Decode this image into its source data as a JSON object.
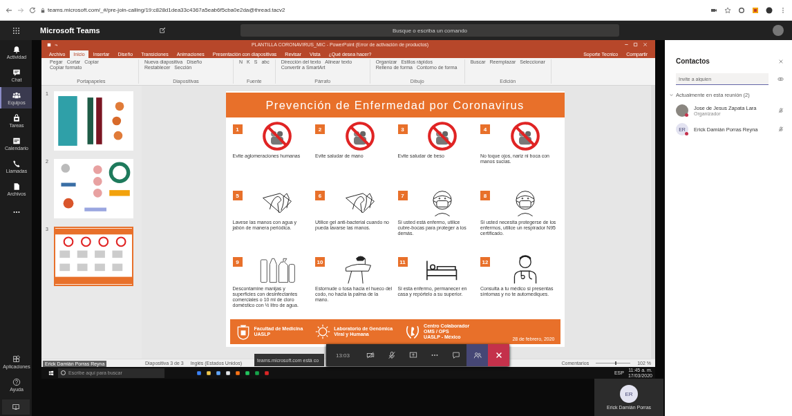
{
  "browser": {
    "url": "teams.microsoft.com/_#/pre-join-calling/19:c828d1dea33c4367a5eab6f5cba0e2da@thread.tacv2"
  },
  "teams_header": {
    "app_name": "Microsoft Teams",
    "search": {
      "placeholder": "Busque o escriba un comando"
    }
  },
  "rail": {
    "items": [
      {
        "label": "Actividad",
        "kind": "bell",
        "selected": false
      },
      {
        "label": "Chat",
        "kind": "chat",
        "selected": false
      },
      {
        "label": "Equipos",
        "kind": "teams",
        "selected": true
      },
      {
        "label": "Tareas",
        "kind": "tasks",
        "selected": false
      },
      {
        "label": "Calendario",
        "kind": "calendar",
        "selected": false
      },
      {
        "label": "Llamadas",
        "kind": "phone",
        "selected": false
      },
      {
        "label": "Archivos",
        "kind": "files",
        "selected": false
      },
      {
        "kind": "more",
        "selected": false
      }
    ],
    "bottom_items": [
      {
        "label": "Aplicaciones",
        "kind": "apps"
      },
      {
        "label": "Ayuda",
        "kind": "help"
      }
    ]
  },
  "shared_screen": {
    "powerpoint": {
      "title": "PLANTILLA CORONAVIRUS_MIC - PowerPoint (Error de activación de productos)",
      "tabs": [
        {
          "label": "Archivo",
          "selected": false
        },
        {
          "label": "Inicio",
          "selected": true
        },
        {
          "label": "Insertar",
          "selected": false
        },
        {
          "label": "Diseño",
          "selected": false
        },
        {
          "label": "Transiciones",
          "selected": false
        },
        {
          "label": "Animaciones",
          "selected": false
        },
        {
          "label": "Presentación con diapositivas",
          "selected": false
        },
        {
          "label": "Revisar",
          "selected": false
        },
        {
          "label": "Vista",
          "selected": false
        }
      ],
      "tell_me": "¿Qué desea hacer?",
      "account": "Soporte Tecnico",
      "share": "Compartir",
      "ribbon_groups": [
        {
          "label": "Portapapeles",
          "buttons": [
            "Pegar",
            "Cortar",
            "Copiar",
            "Copiar formato"
          ]
        },
        {
          "label": "Diapositivas",
          "buttons": [
            "Nueva diapositiva",
            "Diseño",
            "Restablecer",
            "Sección"
          ]
        },
        {
          "label": "Fuente",
          "buttons": [
            "N",
            "K",
            "S",
            "abc"
          ]
        },
        {
          "label": "Párrafo",
          "buttons": [
            "Dirección del texto",
            "Alinear texto",
            "Convertir a SmartArt"
          ]
        },
        {
          "label": "Dibujo",
          "buttons": [
            "Organizar",
            "Estilos rápidos",
            "Relleno de forma",
            "Contorno de forma"
          ]
        },
        {
          "label": "Edición",
          "buttons": [
            "Buscar",
            "Reemplazar",
            "Seleccionar"
          ]
        }
      ],
      "thumbnails": [
        {
          "number": "1",
          "kind": "posters",
          "selected": false
        },
        {
          "number": "2",
          "kind": "infographic",
          "selected": false
        },
        {
          "number": "3",
          "kind": "current",
          "selected": true
        }
      ],
      "slide": {
        "title": "Prevención de Enfermedad por Coronavirus",
        "tips": [
          {
            "number": "1",
            "kind": "prohibited",
            "caption": "Evite aglomeraciones humanas"
          },
          {
            "number": "2",
            "kind": "prohibited",
            "caption": "Evite saludar de mano"
          },
          {
            "number": "3",
            "kind": "prohibited",
            "caption": "Evite saludar de beso"
          },
          {
            "number": "4",
            "kind": "prohibited",
            "caption": "No toque ojos, nariz ni boca con manos sucias."
          },
          {
            "number": "5",
            "kind": "hands",
            "caption": "Lavese las manos con agua y jabón de manera periódica."
          },
          {
            "number": "6",
            "kind": "hands",
            "caption": "Utilice gel anti-bacterial cuando no pueda lavarse las manos."
          },
          {
            "number": "7",
            "kind": "mask",
            "caption": "Si usted está enfermo, utilice cubre-bocas para proteger a los demás."
          },
          {
            "number": "8",
            "kind": "mask",
            "caption": "Si usted necesita protegerse de los enfermos, utilice un respirador N95 certificado."
          },
          {
            "number": "9",
            "kind": "bottles",
            "caption": "Descontamine manijas y superficies con desinfectantes comerciales o 10 ml de cloro doméstico con ½ litro de agua."
          },
          {
            "number": "10",
            "kind": "sneeze",
            "caption": "Estornude o tosa hacia el hueco del codo, no hacia la palma de la mano."
          },
          {
            "number": "11",
            "kind": "bed",
            "caption": "Si esta enfermo, permanecer en casa y repórtelo a su superior."
          },
          {
            "number": "12",
            "kind": "doctor",
            "caption": "Consulta a tu médico si presentas síntomas y no te automediques."
          }
        ],
        "footer": {
          "partners": [
            {
              "kind": "shield",
              "lines": [
                "Facultad de Medicina",
                "UASLP"
              ]
            },
            {
              "kind": "virus",
              "lines": [
                "Laboratorio de Genómica",
                "Viral y Humana"
              ]
            },
            {
              "kind": "laurel",
              "lines": [
                "Centro Colaborador",
                "OMS / OPS",
                "UASLP - México"
              ]
            }
          ],
          "date": "28 de febrero, 2020"
        }
      },
      "status_bar": {
        "slide_count": "Diapositiva 3 de 3",
        "language": "Inglés (Estados Unidos)",
        "comments": "Comentarios",
        "zoom": "102 %",
        "zoom_slider": {
          "level": 0.55
        }
      }
    },
    "taskbar": {
      "search": {
        "placeholder": "Escribe aquí para buscar"
      },
      "language": "ESP",
      "time": "11:45 a. m.",
      "date": "17/03/2020"
    },
    "presenter": "Erick Damián Porras Reyna"
  },
  "sharing_notice": "teams.microsoft.com está co",
  "call_controls": {
    "timer": "13:03",
    "buttons": [
      {
        "kind": "video",
        "selected": false
      },
      {
        "kind": "mic",
        "selected": false
      },
      {
        "kind": "share",
        "selected": false
      },
      {
        "kind": "more",
        "selected": false
      },
      {
        "kind": "chat",
        "selected": false
      },
      {
        "kind": "participants",
        "selected": true
      },
      {
        "kind": "hangup"
      }
    ]
  },
  "self_tile": {
    "initials": "ER",
    "name": "Erick Damián Porras"
  },
  "contacts_panel": {
    "title": "Contactos",
    "invite": {
      "placeholder": "Invite a alguien"
    },
    "section": {
      "label": "Actualmente en esta reunión (2)",
      "expanded": true
    },
    "participants": [
      {
        "name": "Jose de Jesus Zapata Lara",
        "role": "Organizador"
      },
      {
        "name": "Erick Damián Porras Reyna",
        "initials": "ER"
      }
    ]
  }
}
